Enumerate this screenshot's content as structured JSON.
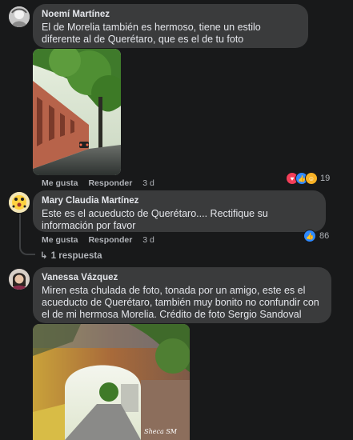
{
  "comments": [
    {
      "author": "Noemí Martínez",
      "text": "El de Morelia también es hermoso, tiene un estilo diferente al de Querétaro, que es el de tu foto",
      "like": "Me gusta",
      "reply": "Responder",
      "time": "3 d",
      "reaction_count": "19",
      "reaction_icons": [
        "heart-icon",
        "like-icon",
        "care-icon"
      ]
    },
    {
      "author": "Mary Claudia Martínez",
      "text": "Este es el acueducto de Querétaro.... Rectifique su información por favor",
      "like": "Me gusta",
      "reply": "Responder",
      "time": "3 d",
      "reaction_count": "86",
      "reaction_icons": [
        "like-icon"
      ],
      "replies_label": "1 respuesta"
    },
    {
      "author": "Vanessa Vázquez",
      "text": "Miren esta chulada de foto, tonada por un amigo, este es el acueducto de Querétaro, también muy bonito no confundir con el de mi hermosa Morelia. Crédito de foto Sergio Sandoval",
      "photo_watermark": "Sheca SM"
    }
  ],
  "colors": {
    "bg": "#18191a",
    "bubble": "#3a3b3c",
    "text": "#e4e6eb",
    "muted": "#b0b3b8",
    "like": "#2e89ff",
    "heart": "#f33e58",
    "care": "#f7b125"
  }
}
